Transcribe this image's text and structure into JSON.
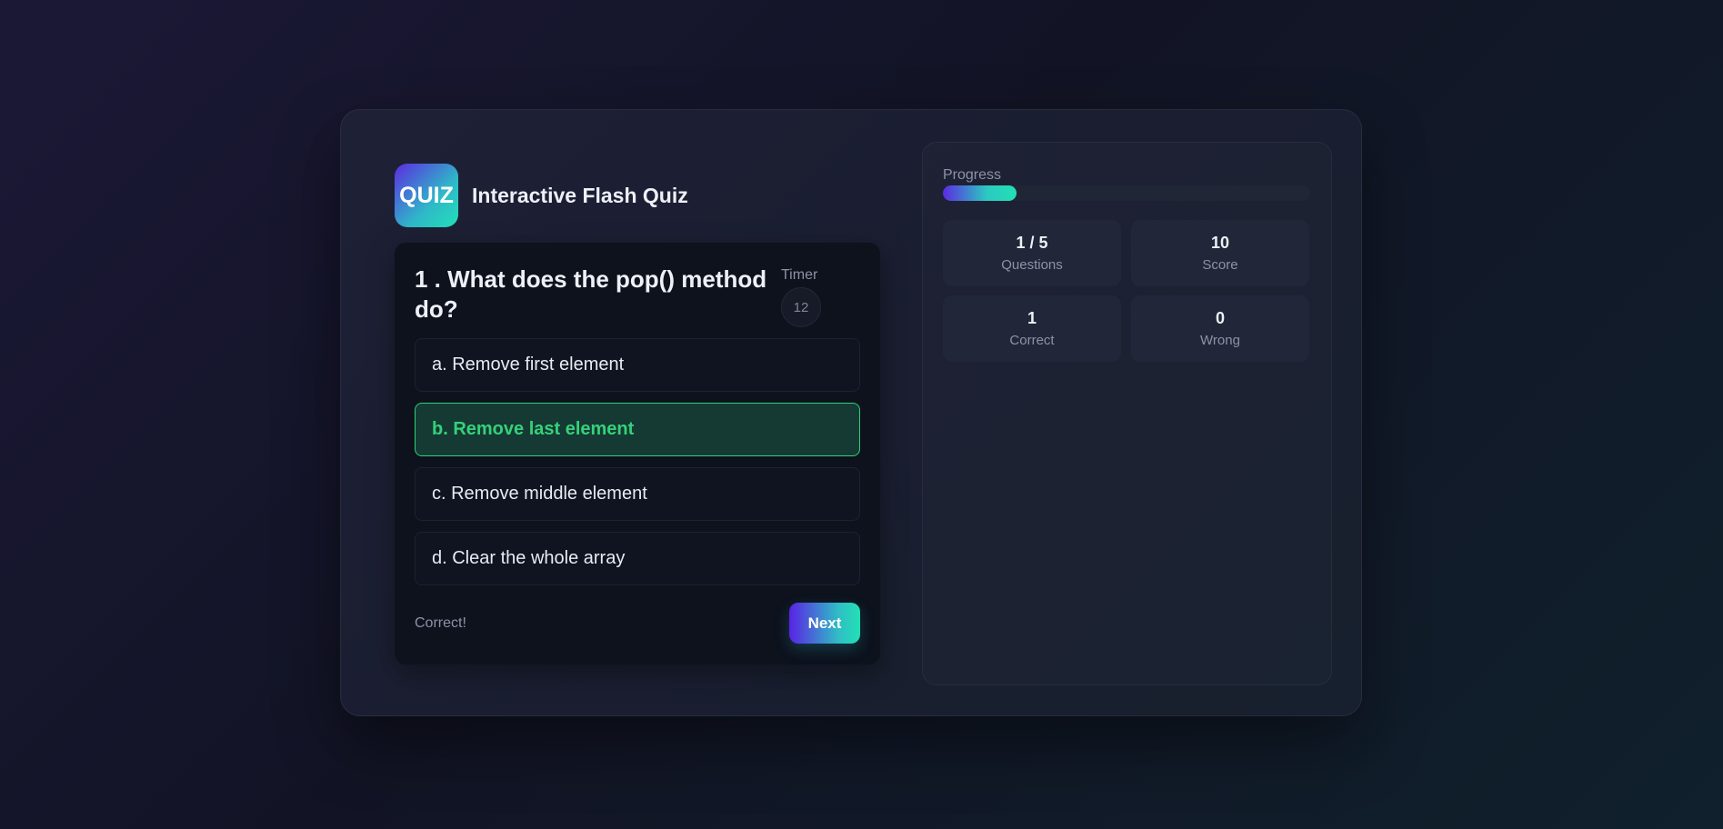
{
  "app": {
    "logo_text": "QUIZ",
    "title": "Interactive Flash Quiz"
  },
  "question": {
    "text": "1 . What does the pop() method do?",
    "timer_label": "Timer",
    "timer_value": "12",
    "options": [
      {
        "label": "a. Remove first element",
        "state": "default"
      },
      {
        "label": "b. Remove last element",
        "state": "correct"
      },
      {
        "label": "c. Remove middle element",
        "state": "default"
      },
      {
        "label": "d. Clear the whole array",
        "state": "default"
      }
    ],
    "feedback": "Correct!",
    "next_label": "Next"
  },
  "progress": {
    "label": "Progress",
    "fraction": 0.2
  },
  "stats": {
    "questions": {
      "value": "1 / 5",
      "label": "Questions"
    },
    "score": {
      "value": "10",
      "label": "Score"
    },
    "correct": {
      "value": "1",
      "label": "Correct"
    },
    "wrong": {
      "value": "0",
      "label": "Wrong"
    }
  },
  "colors": {
    "accent_start": "#5b2be0",
    "accent_end": "#22e0b4",
    "correct_text": "#35d17a",
    "correct_border": "#2fd07a"
  }
}
